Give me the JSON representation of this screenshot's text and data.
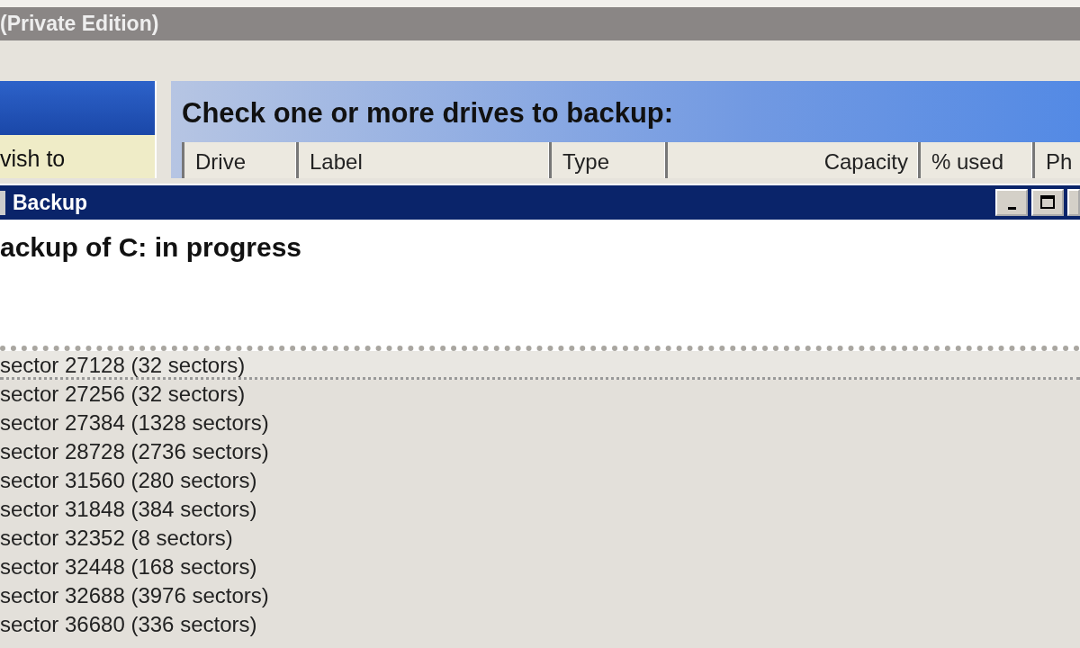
{
  "app_window": {
    "title": "(Private Edition)",
    "sidebar": {
      "text": "vish to"
    },
    "heading": "Check one or more drives to backup:",
    "drive_table": {
      "columns": [
        "Drive",
        "Label",
        "Type",
        "Capacity",
        "% used",
        "Ph"
      ]
    }
  },
  "backup_window": {
    "title": "Backup",
    "status": "ackup of C: in progress",
    "log": [
      {
        "text": "sector 27128 (32 sectors)",
        "selected": true
      },
      {
        "text": "sector 27256 (32 sectors)",
        "selected": false
      },
      {
        "text": "sector 27384 (1328 sectors)",
        "selected": false
      },
      {
        "text": "sector 28728 (2736 sectors)",
        "selected": false
      },
      {
        "text": "sector 31560 (280 sectors)",
        "selected": false
      },
      {
        "text": "sector 31848 (384 sectors)",
        "selected": false
      },
      {
        "text": "sector 32352 (8 sectors)",
        "selected": false
      },
      {
        "text": "sector 32448 (168 sectors)",
        "selected": false
      },
      {
        "text": "sector 32688 (3976 sectors)",
        "selected": false
      },
      {
        "text": "sector 36680 (336 sectors)",
        "selected": false
      }
    ]
  }
}
